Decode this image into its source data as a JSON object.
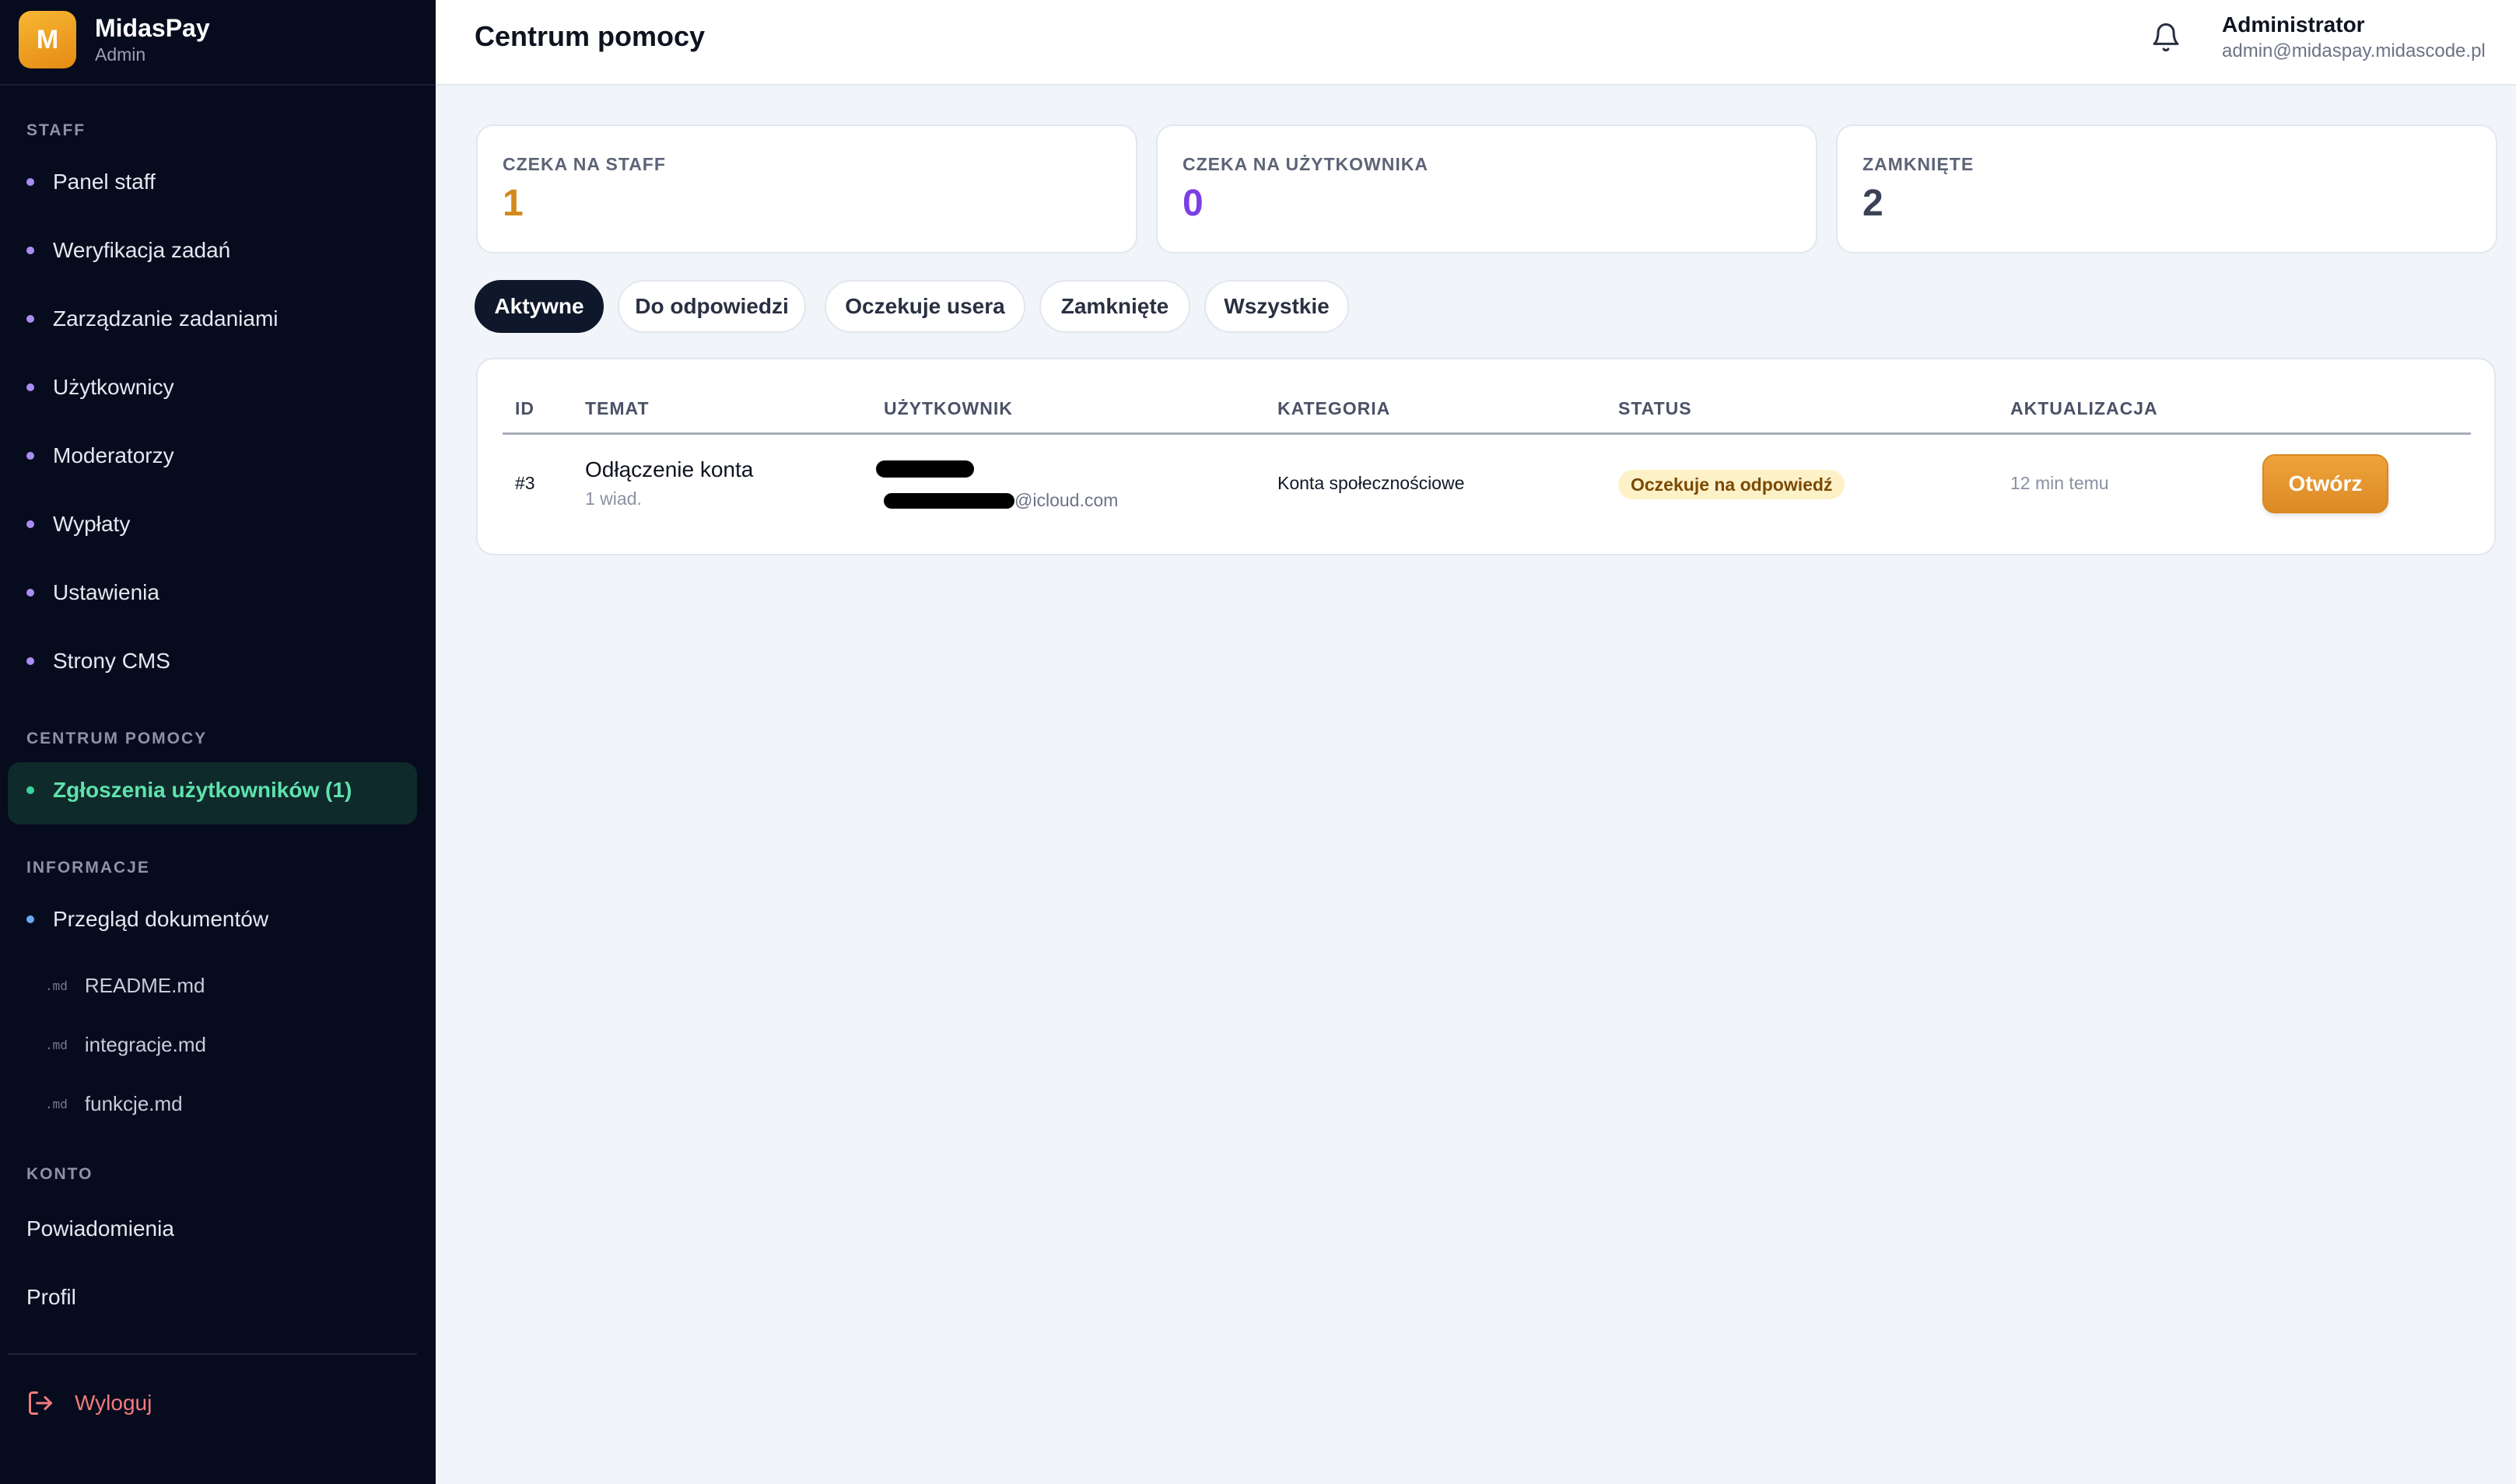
{
  "brand": {
    "logo_letter": "M",
    "name": "MidasPay",
    "subtitle": "Admin"
  },
  "sidebar": {
    "staff_title": "STAFF",
    "staff_items": [
      "Panel staff",
      "Weryfikacja zadań",
      "Zarządzanie zadaniami",
      "Użytkownicy",
      "Moderatorzy",
      "Wypłaty",
      "Ustawienia",
      "Strony CMS"
    ],
    "help_title": "CENTRUM POMOCY",
    "help_item": "Zgłoszenia użytkowników (1)",
    "info_title": "INFORMACJE",
    "info_item": "Przegląd dokumentów",
    "md_tag": ".md",
    "docs": [
      "README.md",
      "integracje.md",
      "funkcje.md"
    ],
    "account_title": "KONTO",
    "account_items": [
      "Powiadomienia",
      "Profil"
    ],
    "logout": "Wyloguj"
  },
  "header": {
    "title": "Centrum pomocy",
    "user_name": "Administrator",
    "user_email": "admin@midaspay.midascode.pl"
  },
  "stats": [
    {
      "label": "CZEKA NA STAFF",
      "value": "1",
      "color": "#d38a1a"
    },
    {
      "label": "CZEKA NA UŻYTKOWNIKA",
      "value": "0",
      "color": "#7b3fe4"
    },
    {
      "label": "ZAMKNIĘTE",
      "value": "2",
      "color": "#3b4256"
    }
  ],
  "tabs": [
    "Aktywne",
    "Do odpowiedzi",
    "Oczekuje usera",
    "Zamknięte",
    "Wszystkie"
  ],
  "table": {
    "headers": [
      "ID",
      "TEMAT",
      "UŻYTKOWNIK",
      "KATEGORIA",
      "STATUS",
      "AKTUALIZACJA"
    ],
    "rows": [
      {
        "id": "#3",
        "subject": "Odłączenie konta",
        "messages": "1 wiad.",
        "email_suffix": "@icloud.com",
        "category": "Konta społecznościowe",
        "status": "Oczekuje na odpowiedź",
        "updated": "12 min temu",
        "action": "Otwórz"
      }
    ]
  },
  "colors": {
    "sidebar_bg": "#070b1e",
    "accent": "#e89a2e",
    "active_nav": "#5fe2ad"
  }
}
